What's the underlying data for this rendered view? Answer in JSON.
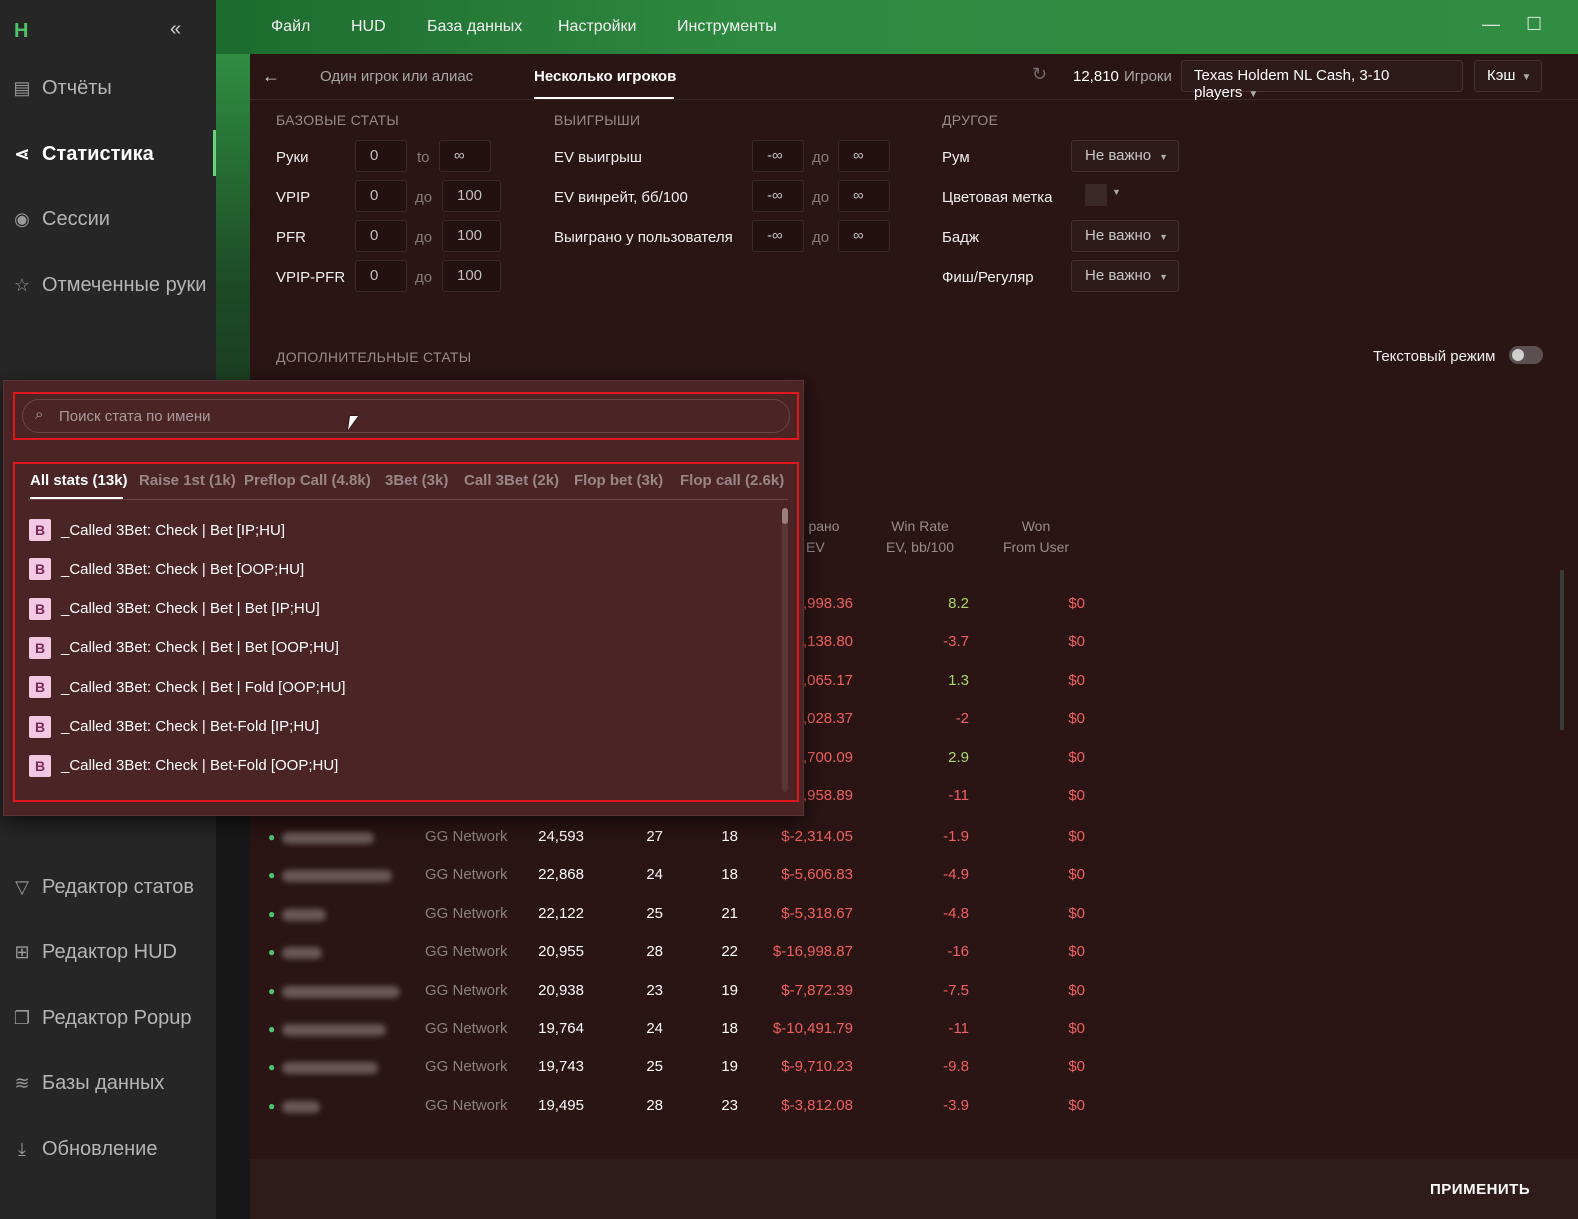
{
  "app": {
    "logo": "H",
    "collapse_icon": "chevron-double-left-icon"
  },
  "sidebar": {
    "items": [
      {
        "label": "Отчёты",
        "icon": "report-icon"
      },
      {
        "label": "Статистика",
        "icon": "share-graph-icon",
        "active": true
      },
      {
        "label": "Сессии",
        "icon": "broadcast-icon"
      },
      {
        "label": "Отмеченные руки",
        "icon": "star-list-icon"
      },
      {
        "label": "Редактор статов",
        "icon": "filter-icon"
      },
      {
        "label": "Редактор HUD",
        "icon": "layout-icon"
      },
      {
        "label": "Редактор Popup",
        "icon": "popup-icon"
      },
      {
        "label": "Базы данных",
        "icon": "database-icon"
      },
      {
        "label": "Обновление",
        "icon": "download-icon"
      }
    ]
  },
  "menu": [
    "Файл",
    "HUD",
    "База данных",
    "Настройки",
    "Инструменты"
  ],
  "tabs": {
    "single": "Один игрок или алиас",
    "multi": "Несколько игроков"
  },
  "header": {
    "players_count": "12,810",
    "players_label": "Игроки",
    "game_select": "Texas Holdem NL Cash, 3-10 players",
    "cache_select": "Кэш"
  },
  "filters": {
    "base_title": "БАЗОВЫЕ СТАТЫ",
    "base": [
      {
        "label": "Руки",
        "from": "0",
        "sep": "to",
        "to": "∞"
      },
      {
        "label": "VPIP",
        "from": "0",
        "sep": "до",
        "to": "100"
      },
      {
        "label": "PFR",
        "from": "0",
        "sep": "до",
        "to": "100"
      },
      {
        "label": "VPIP-PFR",
        "from": "0",
        "sep": "до",
        "to": "100"
      }
    ],
    "win_title": "ВЫИГРЫШИ",
    "win": [
      {
        "label": "EV выигрыш",
        "from": "-∞",
        "sep": "до",
        "to": "∞"
      },
      {
        "label": "EV винрейт, бб/100",
        "from": "-∞",
        "sep": "до",
        "to": "∞"
      },
      {
        "label": "Выиграно у пользователя",
        "from": "-∞",
        "sep": "до",
        "to": "∞"
      }
    ],
    "other_title": "ДРУГОЕ",
    "other": [
      {
        "label": "Рум",
        "value": "Не важно"
      },
      {
        "label": "Цветовая метка",
        "value": ""
      },
      {
        "label": "Бадж",
        "value": "Не важно"
      },
      {
        "label": "Фиш/Регуляр",
        "value": "Не важно"
      }
    ],
    "extra_title": "ДОПОЛНИТЕЛЬНЫЕ СТАТЫ",
    "text_mode": "Текстовый режим"
  },
  "table": {
    "headers": {
      "won_ev_1": "рано",
      "won_ev_2": "EV",
      "wr_1": "Win Rate",
      "wr_2": "EV, bb/100",
      "wu_1": "Won",
      "wu_2": "From User"
    },
    "partial_rows": [
      {
        "won": ",998.36",
        "wr": "8.2",
        "wu": "$0"
      },
      {
        "won": ",138.80",
        "wr": "-3.7",
        "wu": "$0"
      },
      {
        "won": ",065.17",
        "wr": "1.3",
        "wu": "$0"
      },
      {
        "won": ",028.37",
        "wr": "-2",
        "wu": "$0"
      },
      {
        "won": ",700.09",
        "wr": "2.9",
        "wu": "$0"
      },
      {
        "won": ",958.89",
        "wr": "-11",
        "wu": "$0"
      }
    ],
    "rows": [
      {
        "site": "GG Network",
        "hands": "24,593",
        "vpip": "27",
        "pfr": "18",
        "won": "$-2,314.05",
        "wr": "-1.9",
        "wu": "$0"
      },
      {
        "site": "GG Network",
        "hands": "22,868",
        "vpip": "24",
        "pfr": "18",
        "won": "$-5,606.83",
        "wr": "-4.9",
        "wu": "$0"
      },
      {
        "site": "GG Network",
        "hands": "22,122",
        "vpip": "25",
        "pfr": "21",
        "won": "$-5,318.67",
        "wr": "-4.8",
        "wu": "$0"
      },
      {
        "site": "GG Network",
        "hands": "20,955",
        "vpip": "28",
        "pfr": "22",
        "won": "$-16,998.87",
        "wr": "-16",
        "wu": "$0"
      },
      {
        "site": "GG Network",
        "hands": "20,938",
        "vpip": "23",
        "pfr": "19",
        "won": "$-7,872.39",
        "wr": "-7.5",
        "wu": "$0"
      },
      {
        "site": "GG Network",
        "hands": "19,764",
        "vpip": "24",
        "pfr": "18",
        "won": "$-10,491.79",
        "wr": "-11",
        "wu": "$0"
      },
      {
        "site": "GG Network",
        "hands": "19,743",
        "vpip": "25",
        "pfr": "19",
        "won": "$-9,710.23",
        "wr": "-9.8",
        "wu": "$0"
      },
      {
        "site": "GG Network",
        "hands": "19,495",
        "vpip": "28",
        "pfr": "23",
        "won": "$-3,812.08",
        "wr": "-3.9",
        "wu": "$0"
      }
    ]
  },
  "apply": "ПРИМЕНИТЬ",
  "popup": {
    "search_placeholder": "Поиск стата по имени",
    "tabs": [
      "All stats (13k)",
      "Raise 1st (1k)",
      "Preflop Call (4.8k)",
      "3Bet (3k)",
      "Call 3Bet (2k)",
      "Flop bet (3k)",
      "Flop call (2.6k)"
    ],
    "badge": "B",
    "stats": [
      "_Called 3Bet: Check | Bet [IP;HU]",
      "_Called 3Bet: Check | Bet [OOP;HU]",
      "_Called 3Bet: Check | Bet | Bet [IP;HU]",
      "_Called 3Bet: Check | Bet | Bet [OOP;HU]",
      "_Called 3Bet: Check | Bet | Fold [OOP;HU]",
      "_Called 3Bet: Check | Bet-Fold [IP;HU]",
      "_Called 3Bet: Check | Bet-Fold [OOP;HU]"
    ]
  }
}
